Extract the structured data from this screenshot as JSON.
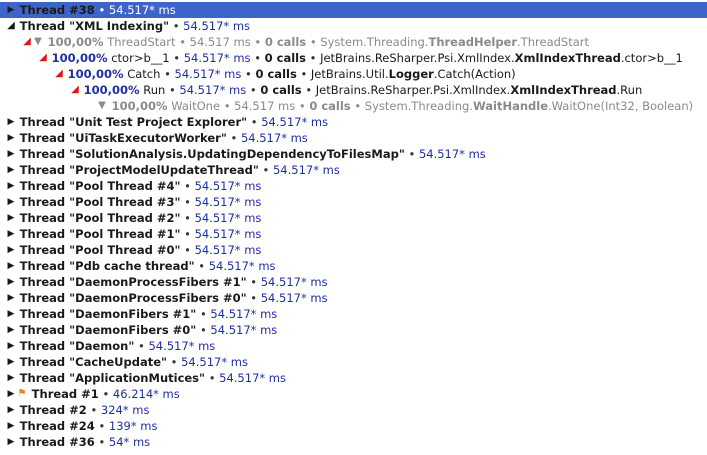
{
  "colors": {
    "selection": "#3b65c8",
    "time": "#1f2fa0",
    "dim": "#8a8a8a",
    "hot": "#d01c1c",
    "flag": "#e08a10"
  },
  "bullet": "•",
  "rows": [
    {
      "kind": "thread",
      "indent": 0,
      "arrow": "collapsed",
      "selected": true,
      "name": "Thread #38",
      "time": "54.517* ms"
    },
    {
      "kind": "thread",
      "indent": 0,
      "arrow": "expanded",
      "name": "Thread \"XML Indexing\"",
      "time": "54.517* ms"
    },
    {
      "kind": "call",
      "indent": 1,
      "arrow": "red",
      "icon": "filter-icon",
      "dim": true,
      "pct": "100,00%",
      "method": "ThreadStart",
      "time": "54.517 ms",
      "calls": "0 calls",
      "ns": "System.Threading.",
      "cls": "ThreadHelper",
      "member": ".ThreadStart"
    },
    {
      "kind": "call",
      "indent": 2,
      "arrow": "red",
      "pct": "100,00%",
      "method": "ctor>b__1",
      "time": "54.517* ms",
      "calls": "0 calls",
      "ns": "JetBrains.ReSharper.Psi.XmlIndex.",
      "cls": "XmlIndexThread",
      "member": ".ctor>b__1"
    },
    {
      "kind": "call",
      "indent": 3,
      "arrow": "red",
      "pct": "100,00%",
      "method": "Catch",
      "time": "54.517* ms",
      "calls": "0 calls",
      "ns": "JetBrains.Util.",
      "cls": "Logger",
      "member": ".Catch(Action)"
    },
    {
      "kind": "call",
      "indent": 4,
      "arrow": "red",
      "pct": "100,00%",
      "method": "Run",
      "time": "54.517* ms",
      "calls": "0 calls",
      "ns": "JetBrains.ReSharper.Psi.XmlIndex.",
      "cls": "XmlIndexThread",
      "member": ".Run"
    },
    {
      "kind": "call",
      "indent": 5,
      "arrow": "none",
      "icon": "filter-icon",
      "dim": true,
      "pct": "100,00%",
      "method": "WaitOne",
      "time": "54.517 ms",
      "calls": "0 calls",
      "ns": "System.Threading.",
      "cls": "WaitHandle",
      "member": ".WaitOne(Int32, Boolean)"
    },
    {
      "kind": "thread",
      "indent": 0,
      "arrow": "collapsed",
      "name": "Thread \"Unit Test Project Explorer\"",
      "time": "54.517* ms"
    },
    {
      "kind": "thread",
      "indent": 0,
      "arrow": "collapsed",
      "name": "Thread \"UiTaskExecutorWorker\"",
      "time": "54.517* ms"
    },
    {
      "kind": "thread",
      "indent": 0,
      "arrow": "collapsed",
      "name": "Thread \"SolutionAnalysis.UpdatingDependencyToFilesMap\"",
      "time": "54.517* ms"
    },
    {
      "kind": "thread",
      "indent": 0,
      "arrow": "collapsed",
      "name": "Thread \"ProjectModelUpdateThread\"",
      "time": "54.517* ms"
    },
    {
      "kind": "thread",
      "indent": 0,
      "arrow": "collapsed",
      "name": "Thread \"Pool Thread #4\"",
      "time": "54.517* ms"
    },
    {
      "kind": "thread",
      "indent": 0,
      "arrow": "collapsed",
      "name": "Thread \"Pool Thread #3\"",
      "time": "54.517* ms"
    },
    {
      "kind": "thread",
      "indent": 0,
      "arrow": "collapsed",
      "name": "Thread \"Pool Thread #2\"",
      "time": "54.517* ms"
    },
    {
      "kind": "thread",
      "indent": 0,
      "arrow": "collapsed",
      "name": "Thread \"Pool Thread #1\"",
      "time": "54.517* ms"
    },
    {
      "kind": "thread",
      "indent": 0,
      "arrow": "collapsed",
      "name": "Thread \"Pool Thread #0\"",
      "time": "54.517* ms"
    },
    {
      "kind": "thread",
      "indent": 0,
      "arrow": "collapsed",
      "name": "Thread \"Pdb cache thread\"",
      "time": "54.517* ms"
    },
    {
      "kind": "thread",
      "indent": 0,
      "arrow": "collapsed",
      "name": "Thread \"DaemonProcessFibers #1\"",
      "time": "54.517* ms"
    },
    {
      "kind": "thread",
      "indent": 0,
      "arrow": "collapsed",
      "name": "Thread \"DaemonProcessFibers #0\"",
      "time": "54.517* ms"
    },
    {
      "kind": "thread",
      "indent": 0,
      "arrow": "collapsed",
      "name": "Thread \"DaemonFibers #1\"",
      "time": "54.517* ms"
    },
    {
      "kind": "thread",
      "indent": 0,
      "arrow": "collapsed",
      "name": "Thread \"DaemonFibers #0\"",
      "time": "54.517* ms"
    },
    {
      "kind": "thread",
      "indent": 0,
      "arrow": "collapsed",
      "name": "Thread \"Daemon\"",
      "time": "54.517* ms"
    },
    {
      "kind": "thread",
      "indent": 0,
      "arrow": "collapsed",
      "name": "Thread \"CacheUpdate\"",
      "time": "54.517* ms"
    },
    {
      "kind": "thread",
      "indent": 0,
      "arrow": "collapsed",
      "name": "Thread \"ApplicationMutices\"",
      "time": "54.517* ms"
    },
    {
      "kind": "thread",
      "indent": 0,
      "arrow": "collapsed",
      "icon": "flag-icon",
      "name": "Thread #1",
      "time": "46.214* ms"
    },
    {
      "kind": "thread",
      "indent": 0,
      "arrow": "collapsed",
      "name": "Thread #2",
      "time": "324* ms"
    },
    {
      "kind": "thread",
      "indent": 0,
      "arrow": "collapsed",
      "name": "Thread #24",
      "time": "139* ms"
    },
    {
      "kind": "thread",
      "indent": 0,
      "arrow": "collapsed",
      "name": "Thread #36",
      "time": "54* ms"
    }
  ]
}
